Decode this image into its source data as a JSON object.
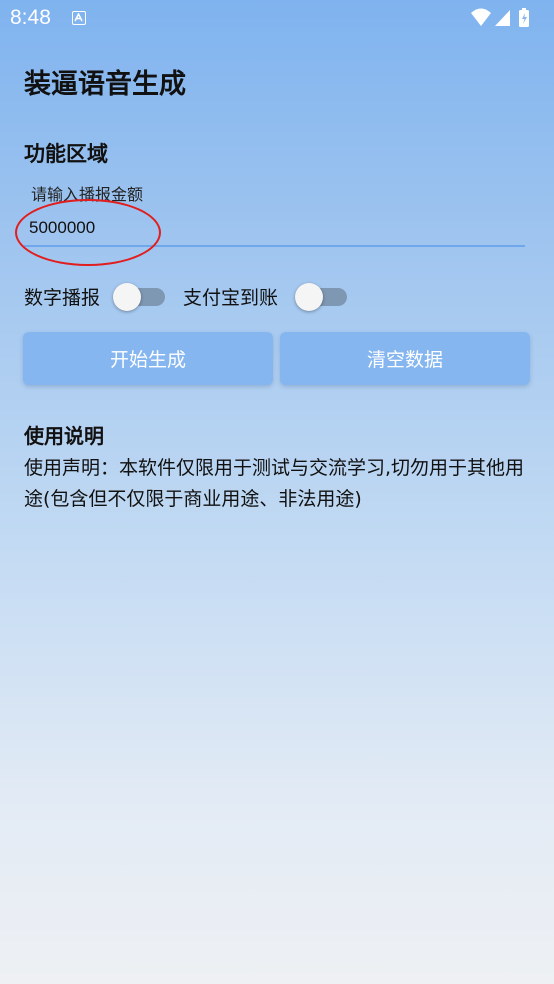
{
  "status_bar": {
    "time": "8:48",
    "icons": [
      "app-a-icon",
      "wifi-icon",
      "signal-icon",
      "battery-icon"
    ]
  },
  "app": {
    "title": "装逼语音生成"
  },
  "function_area": {
    "title": "功能区域",
    "amount_label": "请输入播报金额",
    "amount_value": "5000000"
  },
  "switches": [
    {
      "label": "数字播报",
      "on": false
    },
    {
      "label": "支付宝到账",
      "on": false
    }
  ],
  "buttons": {
    "generate": "开始生成",
    "clear": "清空数据"
  },
  "usage": {
    "title": "使用说明",
    "text": "使用声明：本软件仅限用于测试与交流学习,切勿用于其他用途(包含但不仅限于商业用途、非法用途)"
  },
  "colors": {
    "accent": "#85b6ef",
    "underline": "#6ea7ec",
    "annotation": "#e11d1d"
  }
}
